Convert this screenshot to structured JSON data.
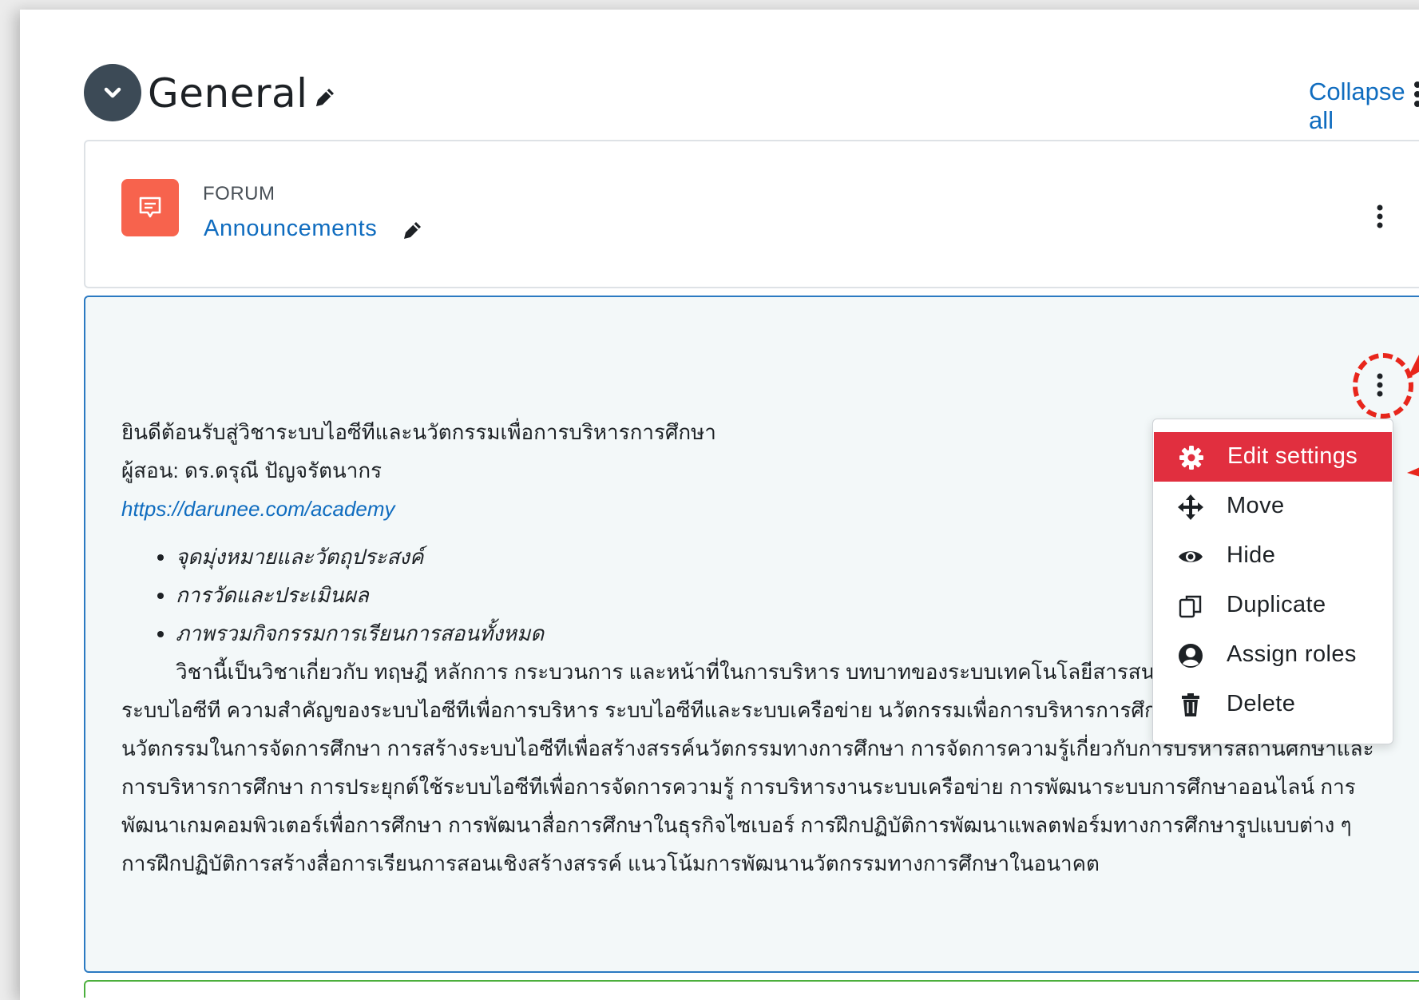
{
  "section": {
    "title": "General",
    "collapse_all_label": "Collapse all"
  },
  "forum": {
    "type_label": "FORUM",
    "name": "Announcements"
  },
  "label": {
    "welcome": "ยินดีต้อนรับสู่วิชาระบบไอซีทีและนวัตกรรมเพื่อการบริหารการศึกษา",
    "instructor": "ผู้สอน: ดร.ดรุณี ปัญจรัตนากร",
    "link": "https://darunee.com/academy",
    "bullets": [
      "จุดมุ่งหมายและวัตถุประสงค์",
      "การวัดและประเมินผล",
      "ภาพรวมกิจกรรมการเรียนการสอนทั้งหมด"
    ],
    "description": "วิชานี้เป็นวิชาเกี่ยวกับ ทฤษฎี หลักการ กระบวนการ และหน้าที่ในการบริหาร บทบาทของระบบเทคโนโลยีสารสนเทศและการสื่อสาร หรือระบบไอซีที ความสำคัญของระบบไอซีทีเพื่อการบริหาร ระบบไอซีทีและระบบเครือข่าย นวัตกรรมเพื่อการบริหารการศึกษา การประยุกต์ใช้นวัตกรรมในการจัดการศึกษา การสร้างระบบไอซีทีเพื่อสร้างสรรค์นวัตกรรมทางการศึกษา การจัดการความรู้เกี่ยวกับการบริหารสถานศึกษาและการบริหารการศึกษา การประยุกต์ใช้ระบบไอซีทีเพื่อการจัดการความรู้ การบริหารงานระบบเครือข่าย การพัฒนาระบบการศึกษาออนไลน์ การพัฒนาเกมคอมพิวเตอร์เพื่อการศึกษา การพัฒนาสื่อการศึกษาในธุรกิจไซเบอร์ การฝึกปฏิบัติการพัฒนาแพลตฟอร์มทางการศึกษารูปแบบต่าง ๆ การฝึกปฏิบัติการสร้างสื่อการเรียนการสอนเชิงสร้างสรรค์ แนวโน้มการพัฒนานวัตกรรมทางการศึกษาในอนาคต"
  },
  "menu": {
    "items": [
      {
        "label": "Edit settings",
        "icon": "gear-icon"
      },
      {
        "label": "Move",
        "icon": "move-icon"
      },
      {
        "label": "Hide",
        "icon": "eye-icon"
      },
      {
        "label": "Duplicate",
        "icon": "copy-icon"
      },
      {
        "label": "Assign roles",
        "icon": "user-circle-icon"
      },
      {
        "label": "Delete",
        "icon": "trash-icon"
      }
    ]
  },
  "colors": {
    "accent": "#0f6cbf",
    "active_menu": "#e12f3f",
    "forum_icon": "#f7634d",
    "annotation": "#e8261c"
  }
}
